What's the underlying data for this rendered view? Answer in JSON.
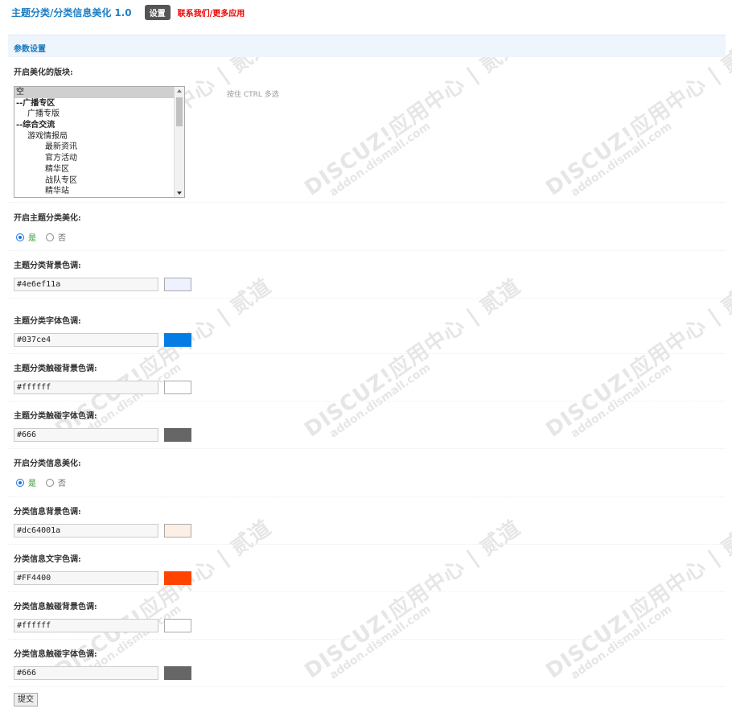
{
  "header": {
    "title": "主题分类/分类信息美化",
    "version": "1.0",
    "settings_button": "设置",
    "links": "联系我们/更多应用"
  },
  "section": {
    "title": "参数设置"
  },
  "boards": {
    "label": "开启美化的版块:",
    "hint": "按住 CTRL 多选",
    "options": [
      "空",
      "--广播专区",
      "广播专版",
      "--综合交流",
      "游戏情报局",
      "最新资讯",
      "官方活动",
      "精华区",
      "战队专区",
      "精华站"
    ]
  },
  "thread_type": {
    "label": "开启主题分类美化:",
    "yes": "是",
    "no": "否",
    "selected": "是"
  },
  "thread_bg": {
    "label": "主题分类背景色调:",
    "value": "#4e6ef11a",
    "swatch": "#eef1fe"
  },
  "thread_font": {
    "label": "主题分类字体色调:",
    "value": "#037ce4",
    "swatch": "#037ce4"
  },
  "thread_hover_bg": {
    "label": "主题分类触碰背景色调:",
    "value": "#ffffff",
    "swatch": "#ffffff"
  },
  "thread_hover_font": {
    "label": "主题分类触碰字体色调:",
    "value": "#666",
    "swatch": "#666666"
  },
  "sort_info": {
    "label": "开启分类信息美化:",
    "yes": "是",
    "no": "否",
    "selected": "是"
  },
  "sort_bg": {
    "label": "分类信息背景色调:",
    "value": "#dc64001a",
    "swatch": "#fcefe5"
  },
  "sort_font": {
    "label": "分类信息文字色调:",
    "value": "#FF4400",
    "swatch": "#ff4400"
  },
  "sort_hover_bg": {
    "label": "分类信息触碰背景色调:",
    "value": "#ffffff",
    "swatch": "#ffffff"
  },
  "sort_hover_font": {
    "label": "分类信息触碰字体色调:",
    "value": "#666",
    "swatch": "#666666"
  },
  "submit": "提交",
  "watermark": {
    "main": "DISCUZ!应用中心 | 贰道",
    "sub": "addon.dismall.com"
  }
}
